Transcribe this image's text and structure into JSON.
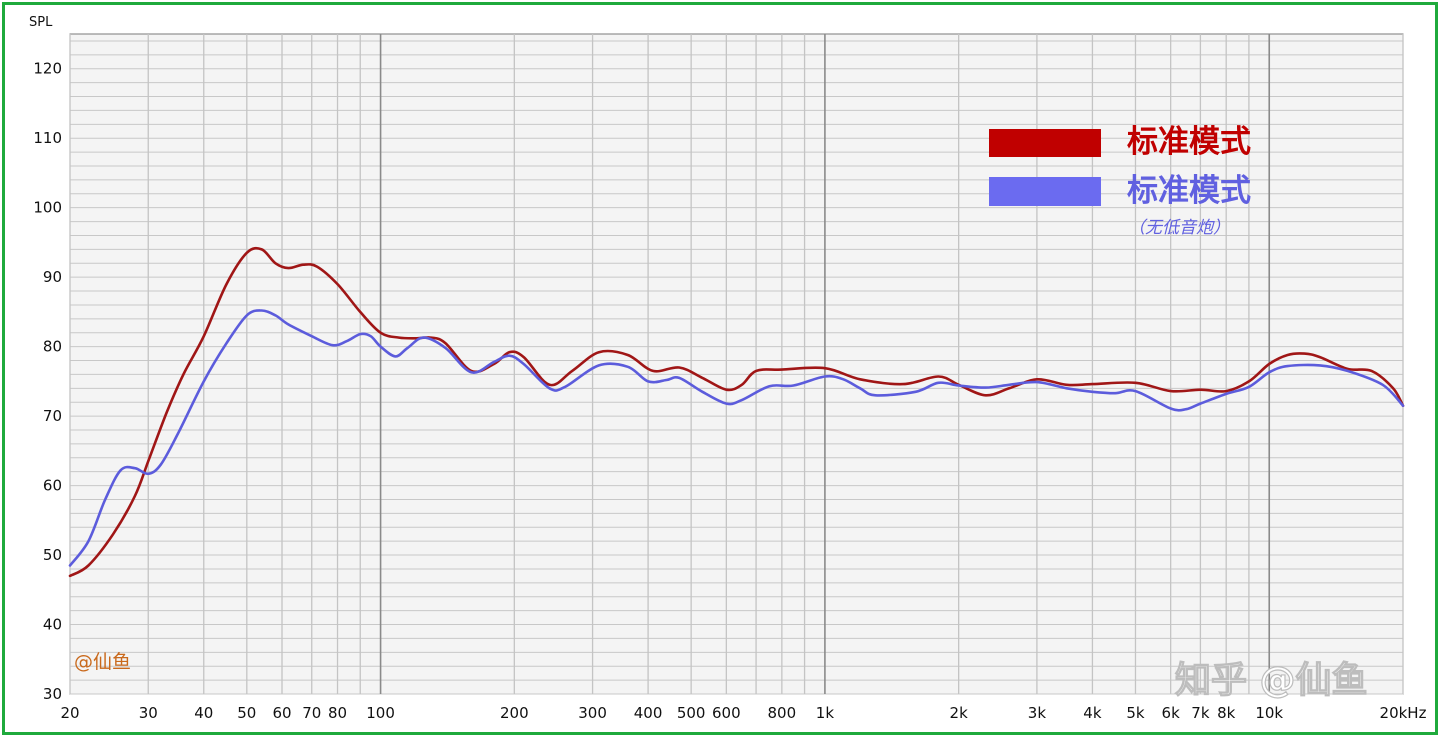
{
  "chart_data": {
    "type": "line",
    "ylabel": "SPL",
    "xscale": "log",
    "xlim": [
      20,
      20000
    ],
    "ylim": [
      30,
      125
    ],
    "y_ticks": [
      30,
      40,
      50,
      60,
      70,
      80,
      90,
      100,
      110,
      120
    ],
    "x_ticks": [
      {
        "v": 20,
        "label": "20"
      },
      {
        "v": 30,
        "label": "30"
      },
      {
        "v": 40,
        "label": "40"
      },
      {
        "v": 50,
        "label": "50"
      },
      {
        "v": 60,
        "label": "60"
      },
      {
        "v": 70,
        "label": "70"
      },
      {
        "v": 80,
        "label": "80"
      },
      {
        "v": 100,
        "label": "100"
      },
      {
        "v": 200,
        "label": "200"
      },
      {
        "v": 300,
        "label": "300"
      },
      {
        "v": 400,
        "label": "400"
      },
      {
        "v": 500,
        "label": "500"
      },
      {
        "v": 600,
        "label": "600"
      },
      {
        "v": 800,
        "label": "800"
      },
      {
        "v": 1000,
        "label": "1k"
      },
      {
        "v": 2000,
        "label": "2k"
      },
      {
        "v": 3000,
        "label": "3k"
      },
      {
        "v": 4000,
        "label": "4k"
      },
      {
        "v": 5000,
        "label": "5k"
      },
      {
        "v": 6000,
        "label": "6k"
      },
      {
        "v": 7000,
        "label": "7k"
      },
      {
        "v": 8000,
        "label": "8k"
      },
      {
        "v": 10000,
        "label": "10k"
      },
      {
        "v": 20000,
        "label": "20kHz"
      }
    ],
    "grid": true,
    "legend_placement": "top-right",
    "series": [
      {
        "name": "标准模式",
        "color": "#a01616",
        "points": [
          [
            20,
            47
          ],
          [
            22,
            48.5
          ],
          [
            25,
            53
          ],
          [
            28,
            58.5
          ],
          [
            30,
            63.5
          ],
          [
            33,
            70.5
          ],
          [
            36,
            76
          ],
          [
            40,
            81.5
          ],
          [
            45,
            89
          ],
          [
            50,
            93.5
          ],
          [
            54,
            94
          ],
          [
            58,
            92
          ],
          [
            62,
            91.3
          ],
          [
            67,
            91.8
          ],
          [
            72,
            91.5
          ],
          [
            80,
            89
          ],
          [
            90,
            85
          ],
          [
            100,
            82
          ],
          [
            110,
            81.3
          ],
          [
            120,
            81.2
          ],
          [
            130,
            81.3
          ],
          [
            140,
            80.5
          ],
          [
            160,
            76.5
          ],
          [
            180,
            77.5
          ],
          [
            195,
            79.2
          ],
          [
            210,
            78.5
          ],
          [
            240,
            74.5
          ],
          [
            270,
            76.5
          ],
          [
            310,
            79.2
          ],
          [
            360,
            78.8
          ],
          [
            410,
            76.5
          ],
          [
            470,
            77
          ],
          [
            530,
            75.5
          ],
          [
            600,
            73.8
          ],
          [
            650,
            74.5
          ],
          [
            700,
            76.5
          ],
          [
            800,
            76.7
          ],
          [
            1000,
            76.9
          ],
          [
            1200,
            75.3
          ],
          [
            1500,
            74.6
          ],
          [
            1800,
            75.7
          ],
          [
            2000,
            74.5
          ],
          [
            2300,
            73
          ],
          [
            2600,
            74
          ],
          [
            3000,
            75.3
          ],
          [
            3500,
            74.5
          ],
          [
            4000,
            74.6
          ],
          [
            5000,
            74.8
          ],
          [
            6000,
            73.6
          ],
          [
            7000,
            73.8
          ],
          [
            8000,
            73.6
          ],
          [
            9000,
            75
          ],
          [
            10000,
            77.5
          ],
          [
            11000,
            78.8
          ],
          [
            12000,
            79
          ],
          [
            13000,
            78.5
          ],
          [
            15000,
            76.8
          ],
          [
            17000,
            76.5
          ],
          [
            19000,
            74
          ],
          [
            20000,
            71.5
          ]
        ]
      },
      {
        "name": "标准模式",
        "sublabel": "（无低音炮）",
        "color": "#5c5cdc",
        "points": [
          [
            20,
            48.5
          ],
          [
            22,
            52
          ],
          [
            24,
            58
          ],
          [
            26,
            62.2
          ],
          [
            28,
            62.5
          ],
          [
            30,
            61.7
          ],
          [
            32,
            63
          ],
          [
            35,
            67.5
          ],
          [
            40,
            75
          ],
          [
            45,
            80.5
          ],
          [
            50,
            84.5
          ],
          [
            54,
            85.2
          ],
          [
            58,
            84.5
          ],
          [
            62,
            83.2
          ],
          [
            70,
            81.5
          ],
          [
            78,
            80.2
          ],
          [
            84,
            80.8
          ],
          [
            90,
            81.8
          ],
          [
            95,
            81.5
          ],
          [
            100,
            80
          ],
          [
            108,
            78.6
          ],
          [
            115,
            79.8
          ],
          [
            125,
            81.3
          ],
          [
            140,
            79.8
          ],
          [
            160,
            76.3
          ],
          [
            180,
            77.8
          ],
          [
            195,
            78.7
          ],
          [
            210,
            77.5
          ],
          [
            240,
            74
          ],
          [
            260,
            74.2
          ],
          [
            310,
            77.3
          ],
          [
            360,
            77.1
          ],
          [
            400,
            75
          ],
          [
            440,
            75.2
          ],
          [
            470,
            75.5
          ],
          [
            530,
            73.5
          ],
          [
            600,
            71.8
          ],
          [
            650,
            72.3
          ],
          [
            750,
            74.3
          ],
          [
            850,
            74.4
          ],
          [
            1000,
            75.7
          ],
          [
            1100,
            75.3
          ],
          [
            1200,
            74
          ],
          [
            1300,
            73
          ],
          [
            1600,
            73.5
          ],
          [
            1800,
            74.8
          ],
          [
            2000,
            74.4
          ],
          [
            2300,
            74.1
          ],
          [
            2600,
            74.5
          ],
          [
            3000,
            74.9
          ],
          [
            3500,
            74
          ],
          [
            4000,
            73.5
          ],
          [
            4500,
            73.3
          ],
          [
            5000,
            73.6
          ],
          [
            6000,
            71.1
          ],
          [
            6500,
            71
          ],
          [
            7000,
            71.8
          ],
          [
            8000,
            73.2
          ],
          [
            9000,
            74.2
          ],
          [
            10000,
            76.3
          ],
          [
            11000,
            77.2
          ],
          [
            13000,
            77.3
          ],
          [
            15000,
            76.5
          ],
          [
            18000,
            74.5
          ],
          [
            20000,
            71.5
          ]
        ]
      }
    ]
  },
  "watermarks": {
    "inner": "@仙鱼",
    "corner": "知乎 @仙鱼"
  }
}
